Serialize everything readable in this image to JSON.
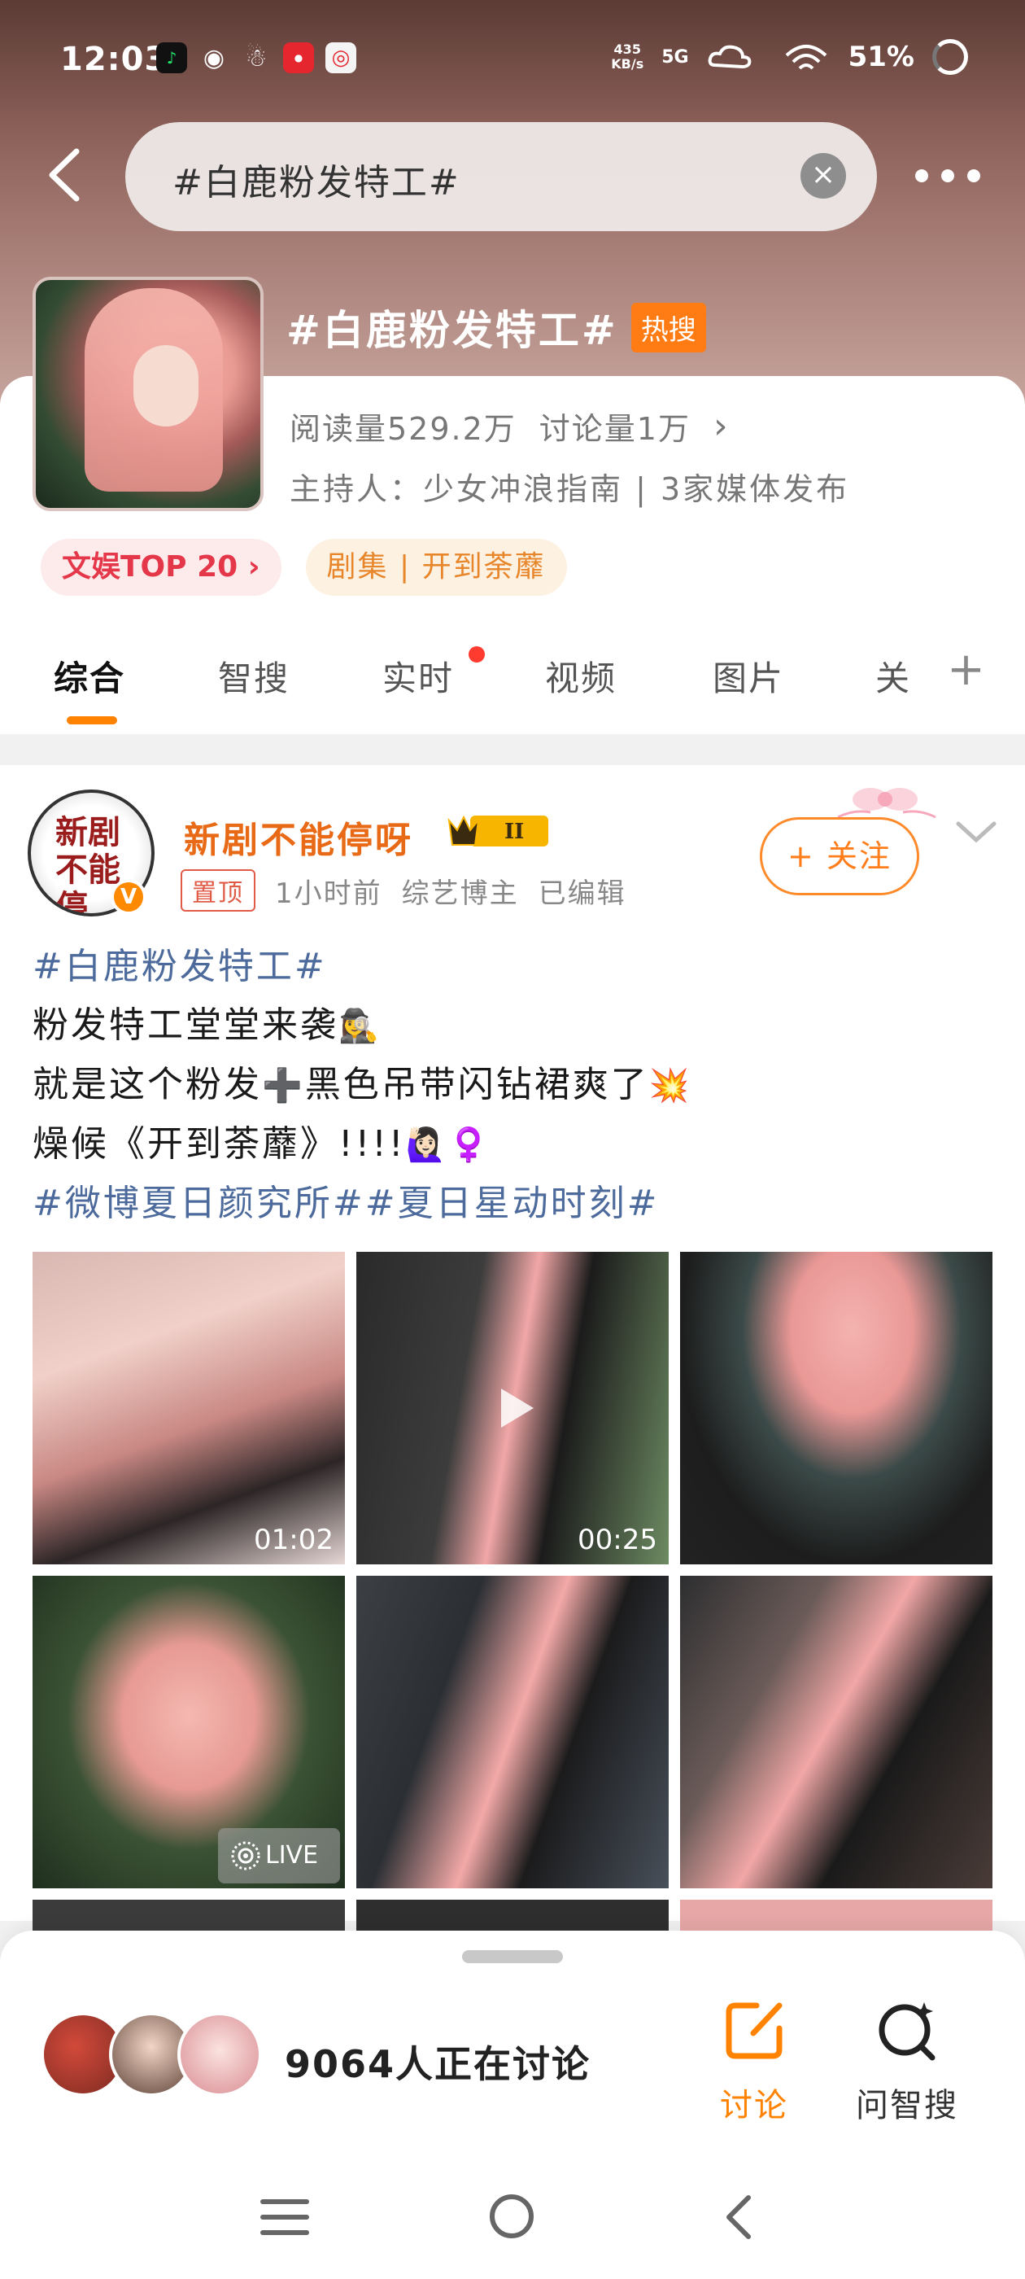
{
  "status_bar": {
    "time": "12:03",
    "net_speed": "435\nKB/s",
    "signal": "5G",
    "battery": "51%"
  },
  "nav": {
    "search_text": "#白鹿粉发特工#",
    "clear_icon": "×"
  },
  "topic": {
    "title": "#白鹿粉发特工#",
    "hot_badge": "热搜",
    "reads": "阅读量529.2万",
    "discussions": "讨论量1万",
    "stats_chevron": "›",
    "host": "主持人：少女冲浪指南 | 3家媒体发布",
    "chips": [
      "文娱TOP 20 ›",
      "剧集 | 开到荼蘼"
    ]
  },
  "tabs": {
    "items": [
      "综合",
      "智搜",
      "实时",
      "视频",
      "图片",
      "关"
    ],
    "active_index": 0,
    "plus": "+"
  },
  "post": {
    "avatar_text": "新剧\n不能停",
    "verified_mark": "V",
    "user_name": "新剧不能停呀",
    "level": "II",
    "pin_label": "置顶",
    "time": "1小时前",
    "user_role": "综艺博主",
    "edited": "已编辑",
    "follow_label": "+ 关注",
    "body": {
      "tag1": "#白鹿粉发特工#",
      "line1": "粉发特工堂堂来袭",
      "emoji1": "🕵️‍♀️",
      "line2a": "就是这个粉发",
      "emoji2": "➕",
      "line2b": "黑色吊带闪钻裙爽了",
      "emoji3": "💥",
      "line3": "燥候《开到荼蘼》!!!!",
      "emoji4": "🙋🏻‍♀️♀️",
      "tags2": "#微博夏日颜究所##夏日星动时刻#"
    },
    "media": [
      {
        "duration": "01:02"
      },
      {
        "duration": "00:25"
      },
      {
        "duration": ""
      },
      {
        "live": "LIVE"
      },
      {
        "duration": ""
      },
      {
        "duration": ""
      }
    ]
  },
  "bottom_sheet": {
    "discuss_count": "9064人正在讨论",
    "discuss_label": "讨论",
    "ask_label": "问智搜"
  },
  "colors": {
    "accent": "#ff8200",
    "tag_blue": "#4c6a9b",
    "hot": "#ff7b14"
  }
}
